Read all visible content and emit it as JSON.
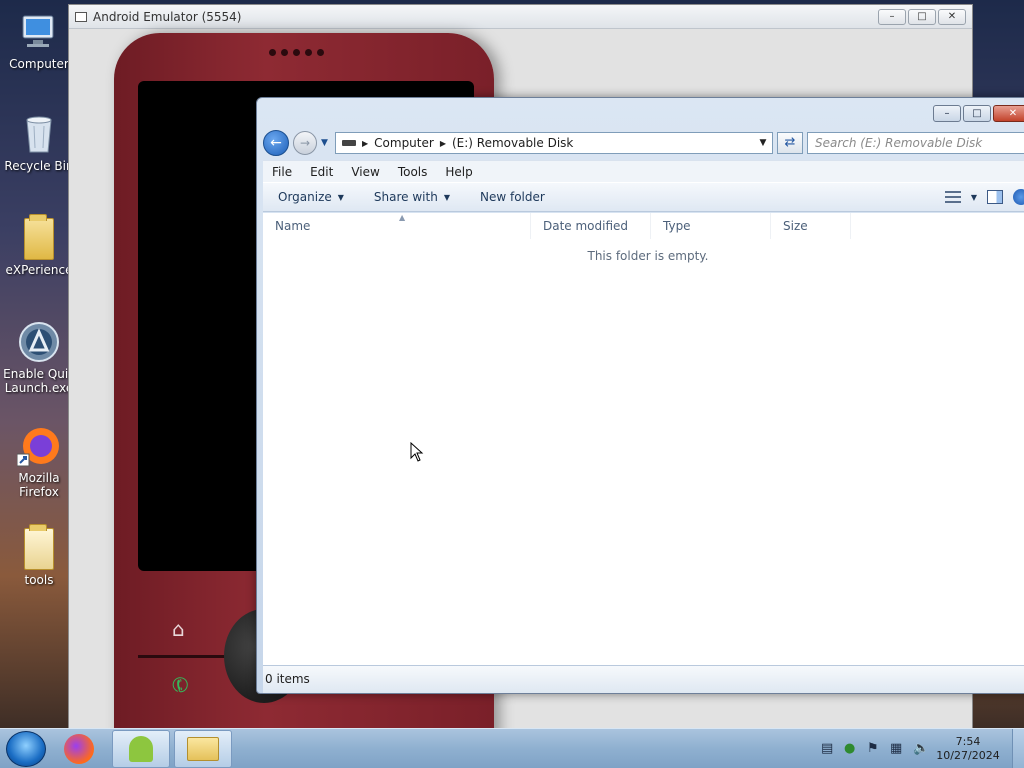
{
  "desktop": {
    "icons": [
      {
        "label": "Computer",
        "icon": "computer-icon"
      },
      {
        "label": "Recycle Bin",
        "icon": "recycle-bin-icon"
      },
      {
        "label": "eXPerience",
        "icon": "folder-icon"
      },
      {
        "label": "Enable Quic\nLaunch.exe",
        "label_line1": "Enable Quic",
        "label_line2": "Launch.exe",
        "icon": "app-icon"
      },
      {
        "label": "Mozilla Firefox",
        "label_line1": "Mozilla",
        "label_line2": "Firefox",
        "icon": "firefox-icon"
      },
      {
        "label": "tools",
        "icon": "folder-icon"
      }
    ]
  },
  "emulator": {
    "title": "Android Emulator (5554)"
  },
  "explorer": {
    "address": {
      "crumb1": "Computer",
      "crumb2": "(E:) Removable Disk"
    },
    "search_placeholder": "Search (E:) Removable Disk",
    "menu": [
      "File",
      "Edit",
      "View",
      "Tools",
      "Help"
    ],
    "commands": {
      "organize": "Organize",
      "share_with": "Share with",
      "new_folder": "New folder"
    },
    "columns": [
      "Name",
      "Date modified",
      "Type",
      "Size"
    ],
    "empty_message": "This folder is empty.",
    "status": "0 items"
  },
  "taskbar": {
    "time": "7:54",
    "date": "10/27/2024"
  },
  "colors": {
    "phone_body": "#8e2a33",
    "explorer_frame": "#c6d6ea",
    "taskbar": "#8fb0d0"
  }
}
